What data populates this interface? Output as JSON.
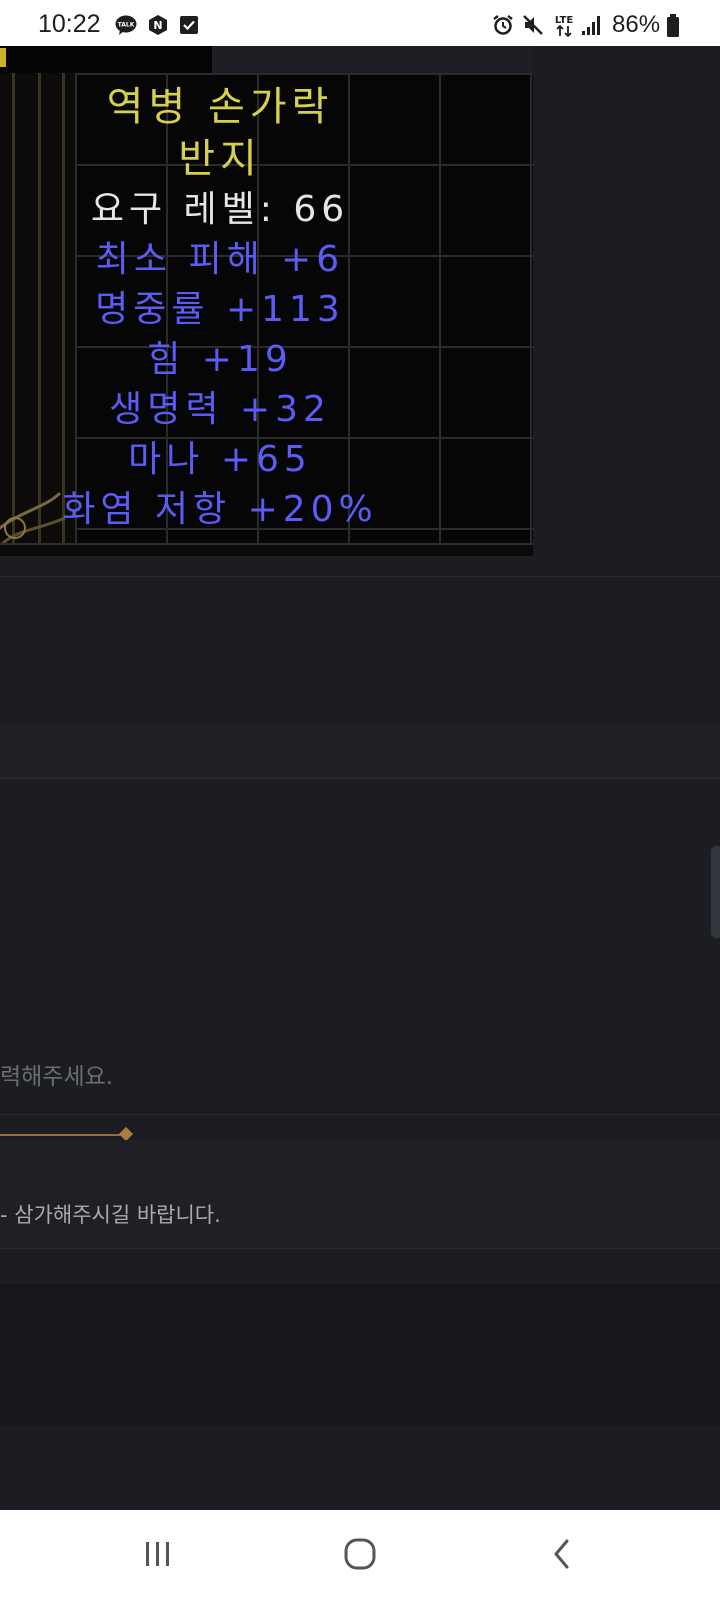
{
  "status_bar": {
    "time": "10:22",
    "talk_badge": "TALK",
    "naver_badge": "N",
    "lte_label": "LTE",
    "battery": "86%",
    "icons": [
      "kakaotalk-icon",
      "naver-icon",
      "checkbox-icon",
      "alarm-icon",
      "mute-icon",
      "lte-icon",
      "signal-icon",
      "battery-icon"
    ]
  },
  "item_tooltip": {
    "name_line1": "역병 손가락",
    "name_line2": "반지",
    "required_level": "요구 레벨: 66",
    "stats": [
      "최소 피해 +6",
      "명중률 +113",
      "힘 +19",
      "생명력 +32",
      "마나 +65",
      "화염 저항 +20%"
    ],
    "colors": {
      "name": "#d7d04d",
      "requirement": "#e6e6e6",
      "magic_stat": "#5a5cf5"
    }
  },
  "page": {
    "input_placeholder": "력해주세요.",
    "notice": "- 삼가해주시길 바랍니다."
  },
  "nav_bar": {
    "buttons": [
      "recents-icon",
      "home-icon",
      "back-icon"
    ]
  }
}
